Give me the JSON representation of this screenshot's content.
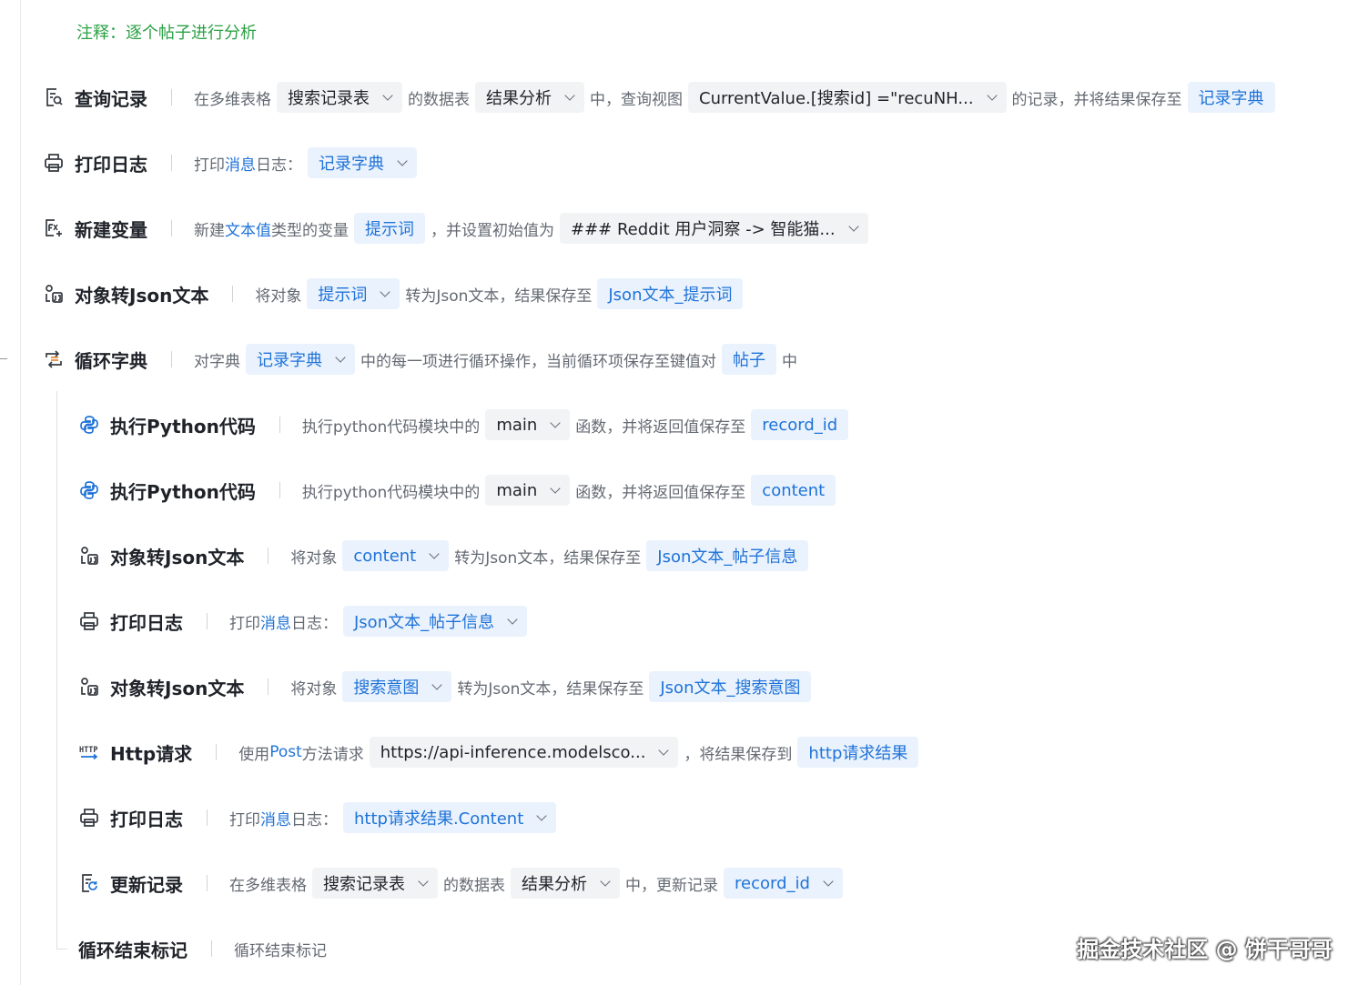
{
  "comment": "注释：逐个帖子进行分析",
  "steps": [
    {
      "icon": "query-record-icon",
      "title": "查询记录",
      "t1": "在多维表格",
      "c1": "搜索记录表",
      "t2": "的数据表",
      "c2": "结果分析",
      "t3": "中，查询视图",
      "c3": "CurrentValue.[搜索id] =\"recuNH...",
      "t4": "的记录，并将结果保存至",
      "c4": "记录字典"
    },
    {
      "icon": "printer-icon",
      "title": "打印日志",
      "t1": "打印",
      "kw": "消息",
      "t2": "日志：",
      "c1": "记录字典"
    },
    {
      "icon": "new-variable-icon",
      "title": "新建变量",
      "t1": "新建",
      "kw": "文本值",
      "t2": "类型的变量",
      "c1": "提示词",
      "t3": "，并设置初始值为",
      "c2": "### Reddit 用户洞察 -> 智能猫..."
    },
    {
      "icon": "object-to-json-icon",
      "title": "对象转Json文本",
      "t1": "将对象",
      "c1": "提示词",
      "t2": "转为Json文本，结果保存至",
      "c2": "Json文本_提示词"
    },
    {
      "icon": "loop-dict-icon",
      "title": "循环字典",
      "t1": "对字典",
      "c1": "记录字典",
      "t2": "中的每一项进行循环操作，当前循环项保存至键值对",
      "c2": "帖子",
      "t3": "中"
    },
    {
      "icon": "python-icon",
      "title": "执行Python代码",
      "t1": "执行python代码模块中的",
      "c1": "main",
      "t2": "函数，并将返回值保存至",
      "c2": "record_id"
    },
    {
      "icon": "python-icon",
      "title": "执行Python代码",
      "t1": "执行python代码模块中的",
      "c1": "main",
      "t2": "函数，并将返回值保存至",
      "c2": "content"
    },
    {
      "icon": "object-to-json-icon",
      "title": "对象转Json文本",
      "t1": "将对象",
      "c1": "content",
      "t2": "转为Json文本，结果保存至",
      "c2": "Json文本_帖子信息"
    },
    {
      "icon": "printer-icon",
      "title": "打印日志",
      "t1": "打印",
      "kw": "消息",
      "t2": "日志：",
      "c1": "Json文本_帖子信息"
    },
    {
      "icon": "object-to-json-icon",
      "title": "对象转Json文本",
      "t1": "将对象",
      "c1": "搜索意图",
      "t2": "转为Json文本，结果保存至",
      "c2": "Json文本_搜索意图"
    },
    {
      "icon": "http-icon",
      "title": "Http请求",
      "t1": "使用",
      "kw": "Post",
      "t2": "方法请求",
      "c1": "https://api-inference.modelsco...",
      "t3": "，将结果保存到",
      "c2": "http请求结果"
    },
    {
      "icon": "printer-icon",
      "title": "打印日志",
      "t1": "打印",
      "kw": "消息",
      "t2": "日志：",
      "c1": "http请求结果.Content"
    },
    {
      "icon": "update-record-icon",
      "title": "更新记录",
      "t1": "在多维表格",
      "c1": "搜索记录表",
      "t2": "的数据表",
      "c2": "结果分析",
      "t3": "中，更新记录",
      "c3": "record_id"
    },
    {
      "title": "循环结束标记",
      "t1": "循环结束标记"
    }
  ],
  "watermark": "掘金技术社区 @ 饼干哥哥"
}
